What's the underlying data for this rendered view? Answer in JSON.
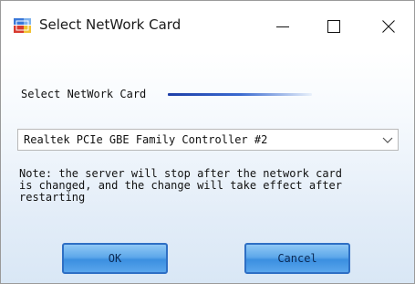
{
  "window": {
    "title": "Select NetWork Card",
    "controls": {
      "minimize_icon": "minimize-icon",
      "maximize_icon": "maximize-icon",
      "close_icon": "close-icon"
    }
  },
  "section": {
    "label": "Select NetWork Card"
  },
  "network_card_select": {
    "selected": "Realtek PCIe GBE Family Controller #2"
  },
  "note": "Note: the server will stop after the network card\nis changed, and the change will take effect after\nrestarting",
  "buttons": {
    "ok_label": "OK",
    "cancel_label": "Cancel"
  },
  "colors": {
    "button_border": "#2e6fc4",
    "button_fill": "#5ea8ea",
    "accent_line": "#1e3fa8"
  }
}
